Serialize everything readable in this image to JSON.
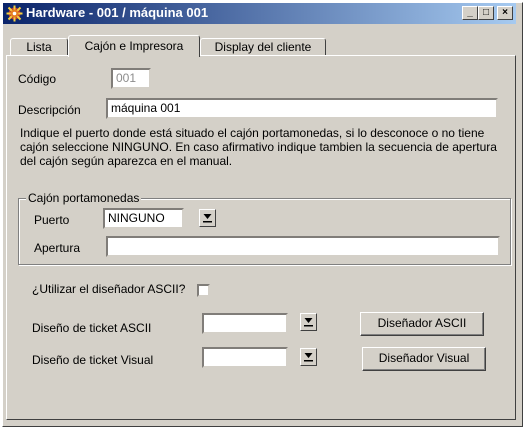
{
  "window": {
    "title": "Hardware - 001 / máquina 001",
    "controls": {
      "minimize": "_",
      "maximize": "□",
      "close": "×"
    }
  },
  "tabs": [
    {
      "label": "Lista",
      "active": false
    },
    {
      "label": "Cajón e Impresora",
      "active": true
    },
    {
      "label": "Display del cliente",
      "active": false
    }
  ],
  "form": {
    "codigo_label": "Código",
    "codigo_value": "001",
    "descripcion_label": "Descripción",
    "descripcion_value": "máquina 001",
    "info_text": "Indique el puerto donde está situado el cajón portamonedas, si lo desconoce o no tiene cajón seleccione NINGUNO. En caso afirmativo indique tambien la secuencia de apertura del cajón según aparezca en el manual.",
    "group_title": "Cajón portamonedas",
    "puerto_label": "Puerto",
    "puerto_value": "NINGUNO",
    "apertura_label": "Apertura",
    "apertura_value": "",
    "ascii_designer_question": "¿Utilizar el diseñador ASCII?",
    "ascii_designer_checked": false,
    "ticket_ascii_label": "Diseño de ticket ASCII",
    "ticket_ascii_value": "",
    "ticket_visual_label": "Diseño de ticket Visual",
    "ticket_visual_value": "",
    "designer_ascii_button": "Diseñador ASCII",
    "designer_visual_button": "Diseñador Visual"
  },
  "colors": {
    "face": "#d4d0c8",
    "titlebar_start": "#0a246a",
    "titlebar_end": "#a6caf0"
  },
  "icons": [
    "app-icon",
    "dropdown-arrow-icon"
  ]
}
